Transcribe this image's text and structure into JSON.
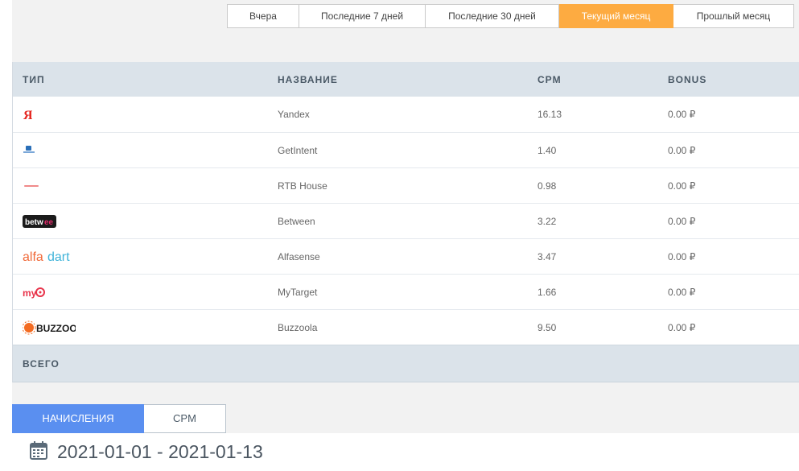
{
  "periods": [
    {
      "label": "Вчера"
    },
    {
      "label": "Последние 7 дней"
    },
    {
      "label": "Последние 30 дней"
    },
    {
      "label": "Текущий месяц",
      "active": true
    },
    {
      "label": "Прошлый месяц"
    }
  ],
  "table": {
    "headers": {
      "type": "ТИП",
      "name": "НАЗВАНИЕ",
      "cpm": "CPM",
      "bonus": "BONUS"
    },
    "rows": [
      {
        "logo": "yandex-logo",
        "name": "Yandex",
        "cpm": "16.13",
        "bonus": "0.00 ₽"
      },
      {
        "logo": "getintent-logo",
        "name": "GetIntent",
        "cpm": "1.40",
        "bonus": "0.00 ₽"
      },
      {
        "logo": "rtbhouse-logo",
        "name": "RTB House",
        "cpm": "0.98",
        "bonus": "0.00 ₽"
      },
      {
        "logo": "between-logo",
        "name": "Between",
        "cpm": "3.22",
        "bonus": "0.00 ₽"
      },
      {
        "logo": "alfadart-logo",
        "name": "Alfasense",
        "cpm": "3.47",
        "bonus": "0.00 ₽"
      },
      {
        "logo": "mytarget-logo",
        "name": "MyTarget",
        "cpm": "1.66",
        "bonus": "0.00 ₽"
      },
      {
        "logo": "buzzoola-logo",
        "name": "Buzzoola",
        "cpm": "9.50",
        "bonus": "0.00 ₽"
      }
    ],
    "total_label": "ВСЕГО"
  },
  "view_tabs": {
    "accruals": "НАЧИСЛЕНИЯ",
    "cpm": "CPM"
  },
  "date_range": "2021-01-01 - 2021-01-13",
  "colors": {
    "accent_orange": "#fdab41",
    "accent_blue": "#5a8ff0"
  }
}
